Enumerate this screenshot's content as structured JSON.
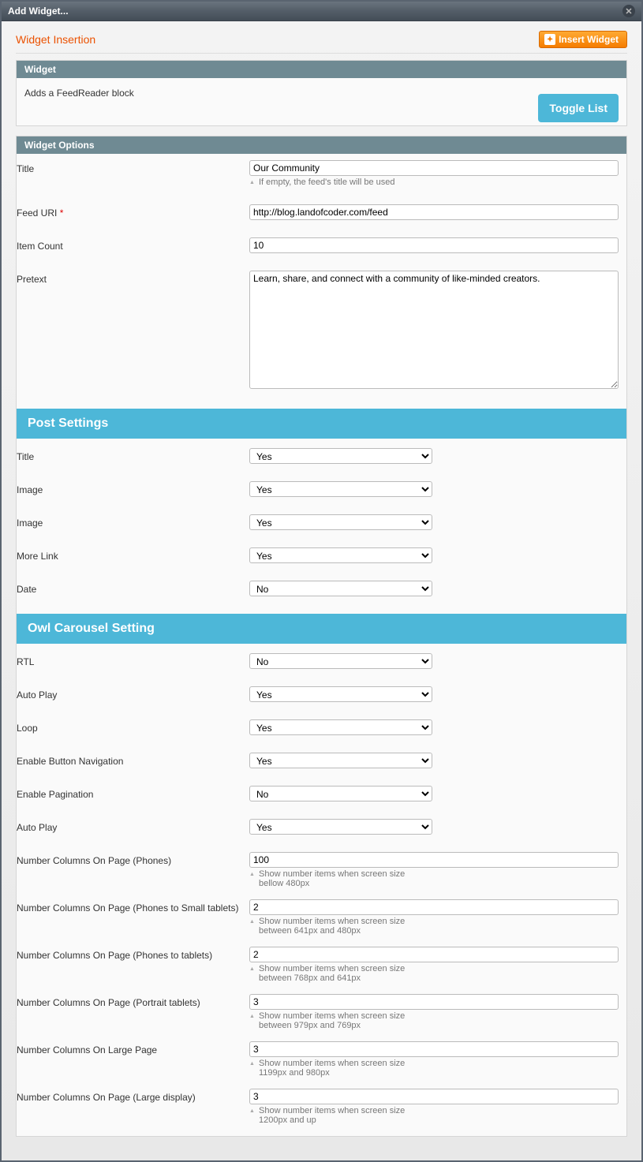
{
  "window_title": "Add Widget...",
  "dialog_title": "Widget Insertion",
  "insert_button": "Insert Widget",
  "widget_panel": {
    "head": "Widget",
    "desc": "Adds a FeedReader block",
    "toggle": "Toggle List"
  },
  "options_panel": {
    "head": "Widget Options"
  },
  "general": {
    "title_label": "Title",
    "title_value": "Our Community",
    "title_hint": "If empty, the feed's title will be used",
    "feed_label": "Feed URI",
    "feed_req": "*",
    "feed_value": "http://blog.landofcoder.com/feed",
    "count_label": "Item Count",
    "count_value": "10",
    "pretext_label": "Pretext",
    "pretext_value": "Learn, share, and connect with a community of like-minded creators."
  },
  "post_section": {
    "head": "Post Settings",
    "title_label": "Title",
    "title_value": "Yes",
    "image_label": "Image",
    "image_value": "Yes",
    "image2_label": "Image",
    "image2_value": "Yes",
    "more_label": "More Link",
    "more_value": "Yes",
    "date_label": "Date",
    "date_value": "No"
  },
  "owl_section": {
    "head": "Owl Carousel Setting",
    "rtl_label": "RTL",
    "rtl_value": "No",
    "autoplay_label": "Auto Play",
    "autoplay_value": "Yes",
    "loop_label": "Loop",
    "loop_value": "Yes",
    "nav_label": "Enable Button Navigation",
    "nav_value": "Yes",
    "pag_label": "Enable Pagination",
    "pag_value": "No",
    "autoplay2_label": "Auto Play",
    "autoplay2_value": "Yes",
    "phones_label": "Number Columns On Page (Phones)",
    "phones_value": "100",
    "phones_hint": "Show number items when screen size bellow 480px",
    "p2st_label": "Number Columns On Page (Phones to Small tablets)",
    "p2st_value": "2",
    "p2st_hint": "Show number items when screen size between 641px and 480px",
    "p2t_label": "Number Columns On Page (Phones to tablets)",
    "p2t_value": "2",
    "p2t_hint": "Show number items when screen size between 768px and 641px",
    "port_label": "Number Columns On Page (Portrait tablets)",
    "port_value": "3",
    "port_hint": "Show number items when screen size between 979px and 769px",
    "large_label": "Number Columns On Large Page",
    "large_value": "3",
    "large_hint": "Show number items when screen size 1199px and 980px",
    "largedisp_label": "Number Columns On Page (Large display)",
    "largedisp_value": "3",
    "largedisp_hint": "Show number items when screen size 1200px and up"
  }
}
